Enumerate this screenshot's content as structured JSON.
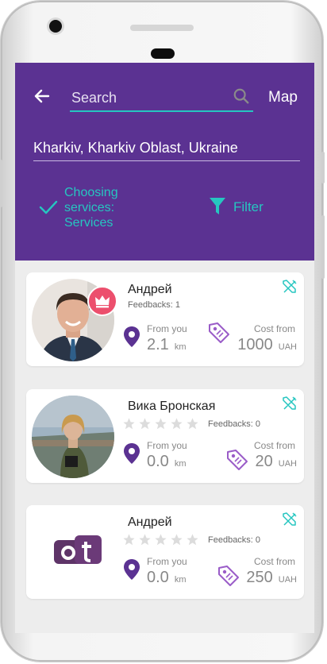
{
  "colors": {
    "header_bg": "#5b3292",
    "accent": "#26c6c0",
    "crown_bg": "#ec4f6d",
    "pin": "#5b3292",
    "tag": "#9a5cc8"
  },
  "header": {
    "search_placeholder": "Search",
    "map_label": "Map",
    "location": "Kharkiv, Kharkiv Oblast, Ukraine",
    "choosing_label": "Choosing services: Services",
    "filter_label": "Filter"
  },
  "cards": [
    {
      "name": "Андрей",
      "feedbacks": "Feedbacks: 1",
      "from_label": "From you",
      "distance": "2.1",
      "distance_unit": "km",
      "cost_label": "Cost from",
      "cost": "1000",
      "currency": "UAH",
      "rating": 0
    },
    {
      "name": "Вика Бронская",
      "feedbacks": "Feedbacks: 0",
      "from_label": "From you",
      "distance": "0.0",
      "distance_unit": "km",
      "cost_label": "Cost from",
      "cost": "20",
      "currency": "UAH",
      "rating": 0
    },
    {
      "name": "Андрей",
      "feedbacks": "Feedbacks: 0",
      "from_label": "From you",
      "distance": "0.0",
      "distance_unit": "km",
      "cost_label": "Cost from",
      "cost": "250",
      "currency": "UAH",
      "rating": 0
    }
  ]
}
